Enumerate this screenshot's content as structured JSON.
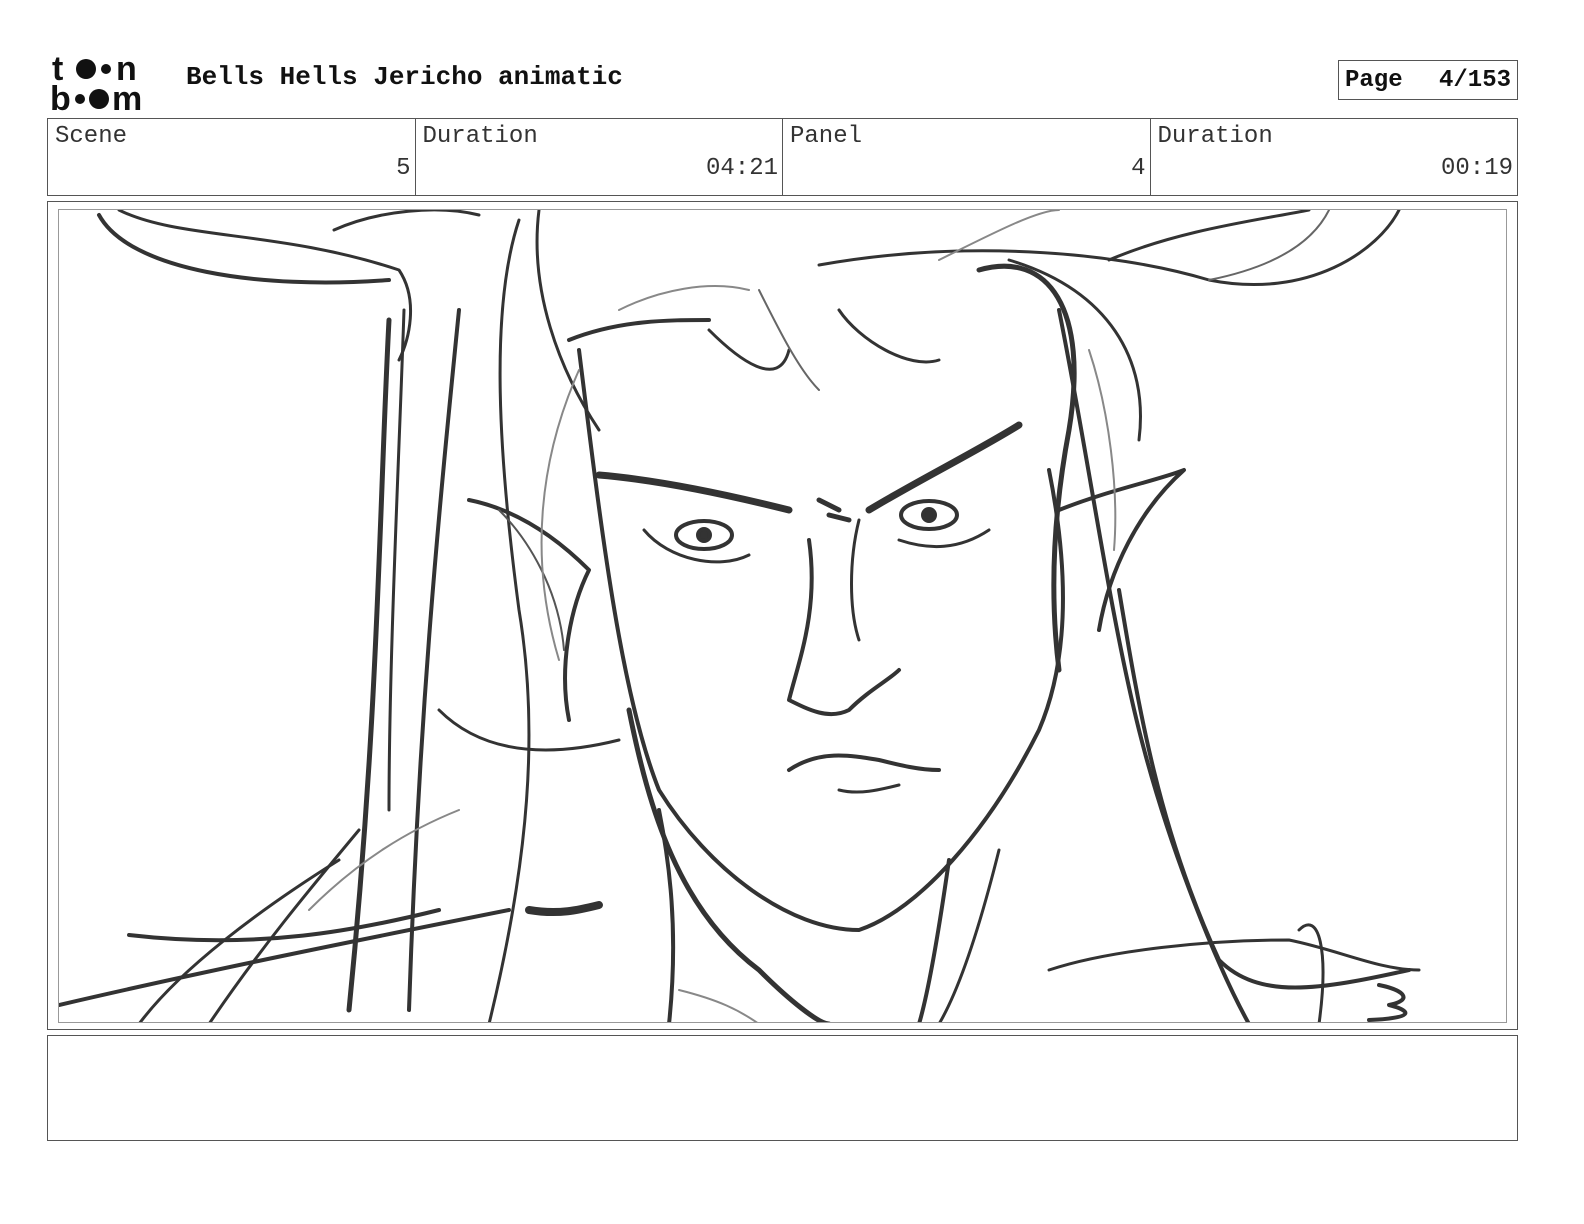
{
  "header": {
    "logo_name": "toon boom",
    "project_title": "Bells Hells Jericho animatic",
    "page_label": "Page",
    "page_number": "4/153"
  },
  "info": {
    "scene_label": "Scene",
    "scene_value": "5",
    "scene_duration_label": "Duration",
    "scene_duration_value": "04:21",
    "panel_label": "Panel",
    "panel_value": "4",
    "panel_duration_label": "Duration",
    "panel_duration_value": "00:19"
  },
  "panel": {
    "content": "rough pencil sketch of an elf with long hair and pointed ears"
  },
  "notes": {
    "text": ""
  }
}
